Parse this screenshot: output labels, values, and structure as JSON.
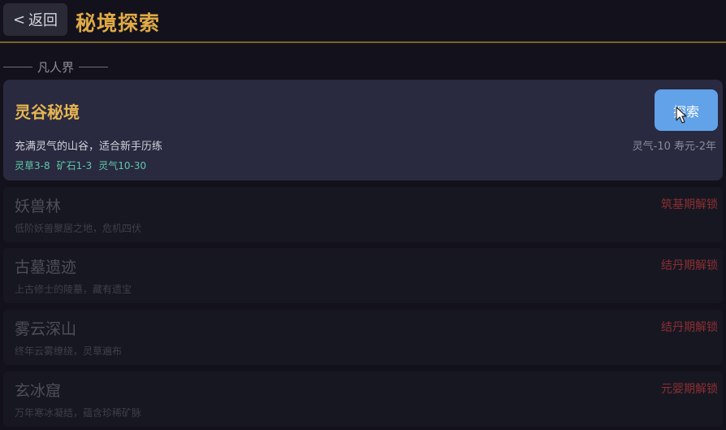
{
  "header": {
    "back_chevron": "<",
    "back_label": "返回",
    "title": "秘境探索"
  },
  "section": {
    "title": "凡人界"
  },
  "realm": {
    "name": "灵谷秘境",
    "description": "充满灵气的山谷，适合新手历练",
    "rewards": [
      "灵草3-8",
      "矿石1-3",
      "灵气10-30"
    ],
    "cost": "灵气-10 寿元-2年",
    "explore_label": "探索"
  },
  "locked_realms": [
    {
      "name": "妖兽林",
      "description": "低阶妖兽聚居之地，危机四伏",
      "unlock": "筑基期解锁"
    },
    {
      "name": "古墓遗迹",
      "description": "上古修士的陵墓，藏有遗宝",
      "unlock": "结丹期解锁"
    },
    {
      "name": "雾云深山",
      "description": "终年云雾缭绕，灵草遍布",
      "unlock": "结丹期解锁"
    },
    {
      "name": "玄冰窟",
      "description": "万年寒冰凝结，蕴含珍稀矿脉",
      "unlock": "元婴期解锁"
    }
  ],
  "colors": {
    "background": "#13121c",
    "accent_gold": "#e0aa47",
    "reward_green": "#5fc9a6",
    "button_blue": "#62a2e8",
    "lock_red": "#8c2f31"
  }
}
